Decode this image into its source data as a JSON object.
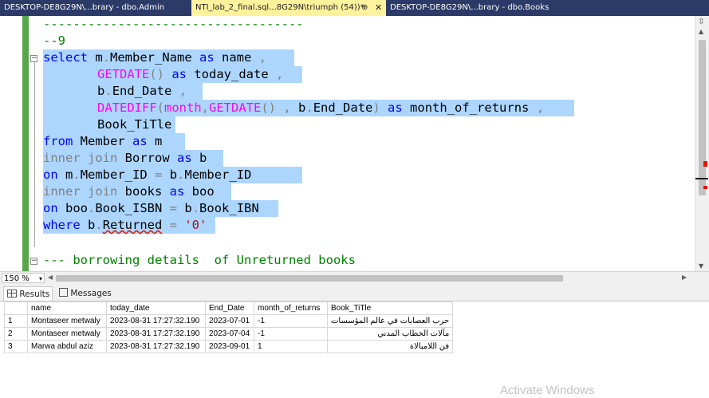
{
  "tabs": [
    {
      "label": "DESKTOP-DE8G29N\\...brary - dbo.Admin",
      "active": false
    },
    {
      "label": "NTI_lab_2_final.sql...8G29N\\triumph (54))*",
      "active": true,
      "pin": "⊕",
      "close": "✕"
    },
    {
      "label": "DESKTOP-DE8G29N\\...brary - dbo.Books",
      "active": false
    }
  ],
  "editor": {
    "line_dashes": "-----------------------------------",
    "line_comment9": "--9",
    "l1": {
      "kw_select": "select",
      "t1": " m",
      "dot": ".",
      "t2": "Member_Name ",
      "kw_as": "as",
      "t3": " name ",
      "comma": ","
    },
    "l2": {
      "fn": "GETDATE",
      "paren": "()",
      "kw_as": "as",
      "t": " today_date ",
      "comma": ","
    },
    "l3": {
      "t1": "b",
      "dot": ".",
      "t2": "End_Date ",
      "comma": ","
    },
    "l4": {
      "fn1": "DATEDIFF",
      "p1": "(",
      "t1": "month",
      "c1": ",",
      "fn2": "GETDATE",
      "p2": "()",
      "c2": " , ",
      "t2": "b",
      "dot": ".",
      "t3": "End_Date",
      "p3": ")",
      "kw_as": "as",
      "t4": " month_of_returns ",
      "comma": ","
    },
    "l5": {
      "t": "Book_TiTle"
    },
    "l6": {
      "kw_from": "from",
      "t1": " Member ",
      "kw_as": "as",
      "t2": " m"
    },
    "l7": {
      "kw_join": "inner join",
      "t1": " Borrow ",
      "kw_as": "as",
      "t2": " b"
    },
    "l8": {
      "kw_on": "on",
      "t1": " m",
      "dot1": ".",
      "t2": "Member_ID ",
      "eq": "=",
      "t3": " b",
      "dot2": ".",
      "t4": "Member_ID"
    },
    "l9": {
      "kw_join": "inner join",
      "t1": " books ",
      "kw_as": "as",
      "t2": " boo"
    },
    "l10": {
      "kw_on": "on",
      "t1": " boo",
      "dot1": ".",
      "t2": "Book_ISBN ",
      "eq": "=",
      "t3": " b",
      "dot2": ".",
      "t4": "Book_IBN"
    },
    "l11": {
      "kw_where": "where",
      "t1": " b",
      "dot": ".",
      "t2": "Returned",
      "eq": " = ",
      "str": "'0'"
    },
    "line_comment_borrow": "--- borrowing details  of Unreturned books"
  },
  "status": {
    "zoom": "150 %"
  },
  "result_tabs": {
    "results": "Results",
    "messages": "Messages"
  },
  "grid": {
    "columns": [
      "name",
      "today_date",
      "End_Date",
      "month_of_returns",
      "Book_TiTle"
    ],
    "rows": [
      {
        "n": "1",
        "name": "Montaseer metwaly",
        "today_date": "2023-08-31 17:27:32.190",
        "end_date": "2023-07-01",
        "months": "-1",
        "title": "حرب العصابات في عالم المؤسسات"
      },
      {
        "n": "2",
        "name": "Montaseer metwaly",
        "today_date": "2023-08-31 17:27:32.190",
        "end_date": "2023-07-04",
        "months": "-1",
        "title": "مآلات الخطاب المدني"
      },
      {
        "n": "3",
        "name": "Marwa abdul aziz",
        "today_date": "2023-08-31 17:27:32.190",
        "end_date": "2023-09-01",
        "months": "1",
        "title": "فن اللامبالاة"
      }
    ]
  },
  "watermark": "Activate Windows",
  "colors": {
    "keyword": "#0000ff",
    "function": "#ff00ff",
    "operator": "#808080",
    "comment": "#008000",
    "string": "#a31515",
    "selection": "#add6ff",
    "tab_active": "#fff29d",
    "tabbar": "#2b3a67"
  },
  "icons": [
    "pin-icon",
    "close-icon",
    "results-grid-icon",
    "messages-icon",
    "split-icon",
    "scroll-up-icon",
    "scroll-left-icon",
    "scroll-right-icon"
  ]
}
